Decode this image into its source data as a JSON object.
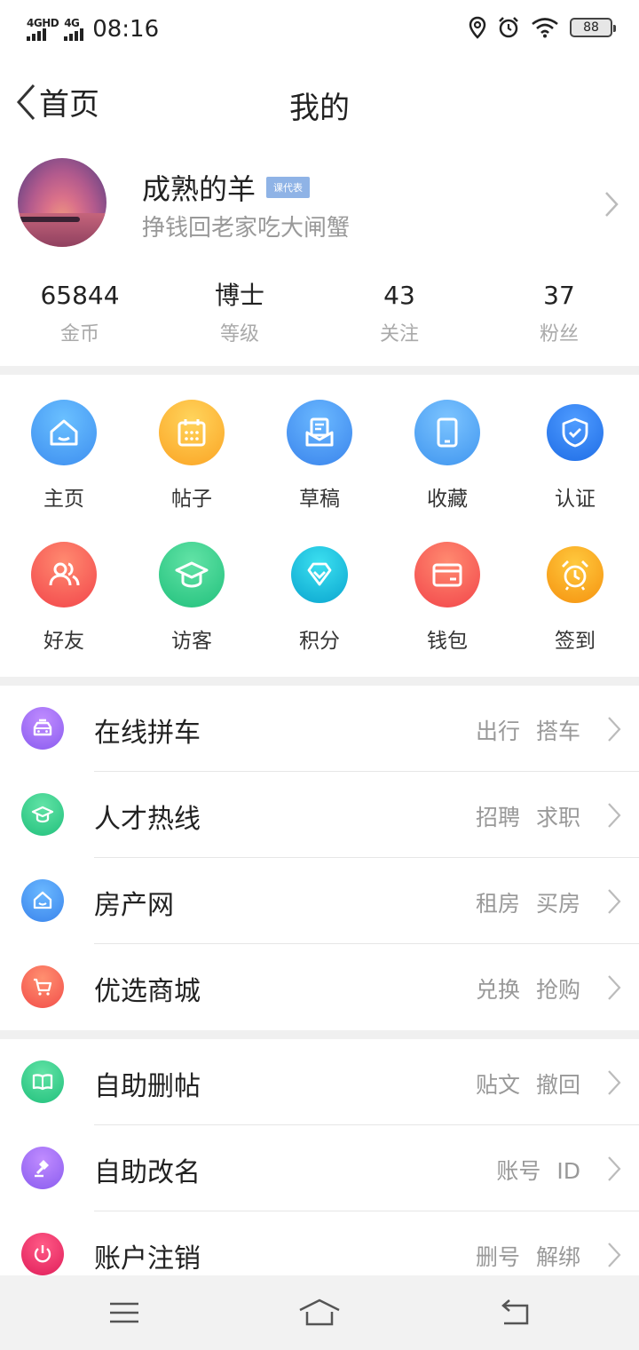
{
  "status_bar": {
    "signal1_label": "4GHD",
    "signal2_label": "4G",
    "time": "08:16",
    "battery": "88"
  },
  "nav": {
    "back_label": "首页",
    "title": "我的"
  },
  "profile": {
    "username": "成熟的羊",
    "badge": "课代表",
    "signature": "挣钱回老家吃大闸蟹"
  },
  "stats": [
    {
      "value": "65844",
      "label": "金币"
    },
    {
      "value": "博士",
      "label": "等级"
    },
    {
      "value": "43",
      "label": "关注"
    },
    {
      "value": "37",
      "label": "粉丝"
    }
  ],
  "grid": [
    {
      "label": "主页",
      "icon": "home-icon",
      "color": "#3d9cf5"
    },
    {
      "label": "帖子",
      "icon": "calendar-icon",
      "color": "#fbb12b"
    },
    {
      "label": "草稿",
      "icon": "draft-icon",
      "color": "#3f8ef0"
    },
    {
      "label": "收藏",
      "icon": "tablet-icon",
      "color": "#4ea6f5"
    },
    {
      "label": "认证",
      "icon": "shield-check-icon",
      "color": "#2a7ef0"
    },
    {
      "label": "好友",
      "icon": "friends-icon",
      "color": "#f5584e"
    },
    {
      "label": "访客",
      "icon": "graduation-cap-icon",
      "color": "#2fd08a"
    },
    {
      "label": "积分",
      "icon": "diamond-icon",
      "color": "#10b8d6"
    },
    {
      "label": "钱包",
      "icon": "wallet-icon",
      "color": "#f5584e"
    },
    {
      "label": "签到",
      "icon": "alarm-clock-icon",
      "color": "#f9a21c"
    }
  ],
  "list1": [
    {
      "title": "在线拼车",
      "tags": "出行 搭车",
      "icon": "car-icon",
      "color": "#9b6cf2"
    },
    {
      "title": "人才热线",
      "tags": "招聘 求职",
      "icon": "graduation-cap-icon",
      "color": "#2fcf8a"
    },
    {
      "title": "房产网",
      "tags": "租房 买房",
      "icon": "house-icon",
      "color": "#3d97f2"
    },
    {
      "title": "优选商城",
      "tags": "兑换 抢购",
      "icon": "cart-icon",
      "color": "#f5654e"
    }
  ],
  "list2": [
    {
      "title": "自助删帖",
      "tags": "贴文 撤回",
      "icon": "book-icon",
      "color": "#2fcf8a"
    },
    {
      "title": "自助改名",
      "tags": "账号 ID",
      "icon": "gavel-icon",
      "color": "#9b6cf2"
    },
    {
      "title": "账户注销",
      "tags": "删号 解绑",
      "icon": "power-icon",
      "color": "#f0336b"
    }
  ]
}
